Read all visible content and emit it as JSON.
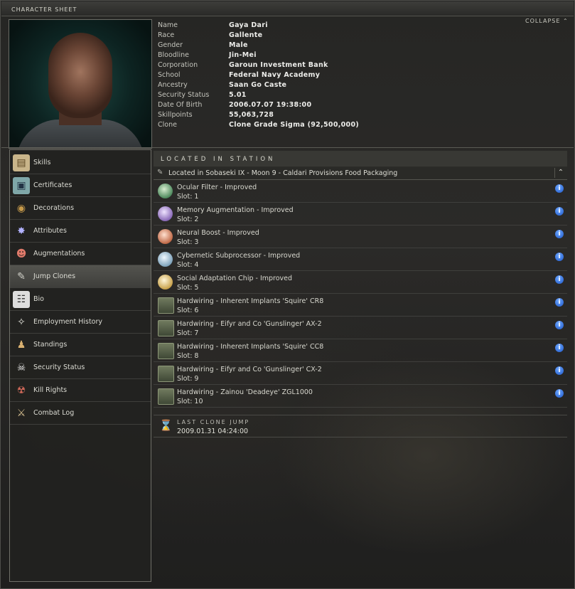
{
  "window": {
    "title": "CHARACTER SHEET",
    "collapse_label": "COLLAPSE"
  },
  "character": {
    "fields": [
      {
        "label": "Name",
        "value": "Gaya Dari"
      },
      {
        "label": "Race",
        "value": "Gallente"
      },
      {
        "label": "Gender",
        "value": "Male"
      },
      {
        "label": "Bloodline",
        "value": "Jin-Mei"
      },
      {
        "label": "Corporation",
        "value": "Garoun Investment Bank"
      },
      {
        "label": "School",
        "value": "Federal Navy Academy"
      },
      {
        "label": "Ancestry",
        "value": "Saan Go Caste"
      },
      {
        "label": "Security Status",
        "value": "5.01"
      },
      {
        "label": "Date Of Birth",
        "value": "2006.07.07 19:38:00"
      },
      {
        "label": "Skillpoints",
        "value": "55,063,728"
      },
      {
        "label": "Clone",
        "value": "Clone Grade Sigma (92,500,000)"
      }
    ]
  },
  "sidebar": {
    "items": [
      {
        "label": "Skills",
        "icon": "book-icon"
      },
      {
        "label": "Certificates",
        "icon": "certificate-icon"
      },
      {
        "label": "Decorations",
        "icon": "medal-icon"
      },
      {
        "label": "Attributes",
        "icon": "attributes-icon"
      },
      {
        "label": "Augmentations",
        "icon": "augmentation-icon"
      },
      {
        "label": "Jump Clones",
        "icon": "jump-clone-icon",
        "active": true
      },
      {
        "label": "Bio",
        "icon": "bio-icon"
      },
      {
        "label": "Employment History",
        "icon": "employment-icon"
      },
      {
        "label": "Standings",
        "icon": "standings-icon"
      },
      {
        "label": "Security Status",
        "icon": "skull-icon"
      },
      {
        "label": "Kill Rights",
        "icon": "kill-rights-icon"
      },
      {
        "label": "Combat Log",
        "icon": "crossed-swords-icon"
      }
    ]
  },
  "jump_clone": {
    "header": "LOCATED IN STATION",
    "location": "Located in Sobaseki IX - Moon 9 - Caldari Provisions Food Packaging",
    "implants": [
      {
        "name": "Ocular Filter - Improved",
        "slot": "Slot: 1",
        "icon": "ocular-filter-icon",
        "color": "#7fbf8f"
      },
      {
        "name": "Memory Augmentation - Improved",
        "slot": "Slot: 2",
        "icon": "memory-augmentation-icon",
        "color": "#b79ad8"
      },
      {
        "name": "Neural Boost - Improved",
        "slot": "Slot: 3",
        "icon": "neural-boost-icon",
        "color": "#d08a6a"
      },
      {
        "name": "Cybernetic Subprocessor - Improved",
        "slot": "Slot: 4",
        "icon": "cybernetic-subprocessor-icon",
        "color": "#a9c8dc"
      },
      {
        "name": "Social Adaptation Chip - Improved",
        "slot": "Slot: 5",
        "icon": "social-adaptation-icon",
        "color": "#d8c07a"
      },
      {
        "name": "Hardwiring - Inherent Implants 'Squire' CR8",
        "slot": "Slot: 6",
        "icon": "hardwiring-chip-icon"
      },
      {
        "name": "Hardwiring - Eifyr and Co 'Gunslinger' AX-2",
        "slot": "Slot: 7",
        "icon": "hardwiring-chip-icon"
      },
      {
        "name": "Hardwiring - Inherent Implants 'Squire' CC8",
        "slot": "Slot: 8",
        "icon": "hardwiring-chip-icon"
      },
      {
        "name": "Hardwiring - Eifyr and Co 'Gunslinger' CX-2",
        "slot": "Slot: 9",
        "icon": "hardwiring-chip-icon"
      },
      {
        "name": "Hardwiring - Zainou 'Deadeye' ZGL1000",
        "slot": "Slot: 10",
        "icon": "hardwiring-chip-icon"
      }
    ],
    "last_jump": {
      "label": "LAST CLONE JUMP",
      "value": "2009.01.31 04:24:00"
    }
  }
}
